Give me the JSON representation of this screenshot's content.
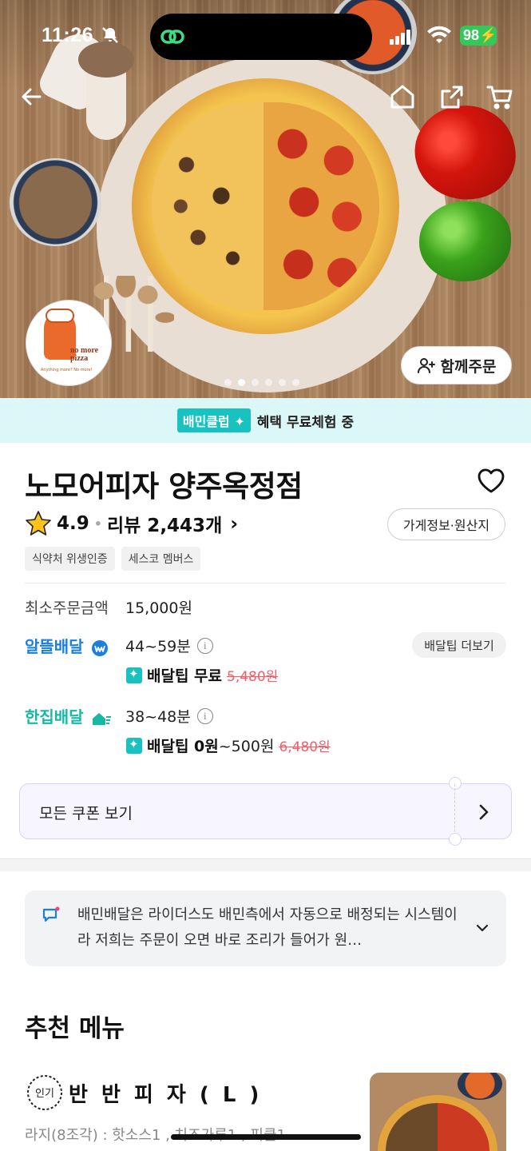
{
  "status_bar": {
    "time": "11:26",
    "battery": "98"
  },
  "hero": {
    "logo": {
      "brand": "no more pizza",
      "tagline": "Anything more? No more!"
    },
    "together_order_label": "함께주문",
    "carousel_dots": 6,
    "carousel_active": 1
  },
  "club_banner": {
    "badge": "배민클럽",
    "text": "혜택 무료체험 중"
  },
  "store": {
    "name": "노모어피자 양주옥정점",
    "rating": "4.9",
    "review_label": "리뷰 2,443개",
    "info_button": "가게정보·원산지",
    "tags": [
      "식약처 위생인증",
      "세스코 멤버스"
    ]
  },
  "order_info": {
    "min_order_label": "최소주문금액",
    "min_order_value": "15,000원",
    "tip_more": "배달팁 더보기",
    "alddeul": {
      "name": "알뜰배달",
      "time": "44~59분",
      "tip_bold": "배달팁 무료",
      "tip_normal": "",
      "tip_original": "5,480원"
    },
    "hanjip": {
      "name": "한집배달",
      "time": "38~48분",
      "tip_bold": "배달팁 0원",
      "tip_normal": "~500원",
      "tip_original": "6,480원"
    }
  },
  "coupon": {
    "label": "모든 쿠폰 보기"
  },
  "notice": {
    "text": "배민배달은 라이더스도 배민측에서 자동으로 배정되는 시스템이라 저희는 주문이 오면 바로 조리가 들어가 원…"
  },
  "recommended": {
    "title": "추천 메뉴",
    "items": [
      {
        "badge": "인기",
        "name": "반 반 피 자 ( L )",
        "desc": "라지(8조각) : 핫소스1 , 치즈가루1 , 피클1"
      }
    ]
  },
  "colors": {
    "club": "#18c2c0",
    "alddeul": "#1b7fe0",
    "hanjip": "#18b8a8",
    "strike": "#f0606a"
  }
}
